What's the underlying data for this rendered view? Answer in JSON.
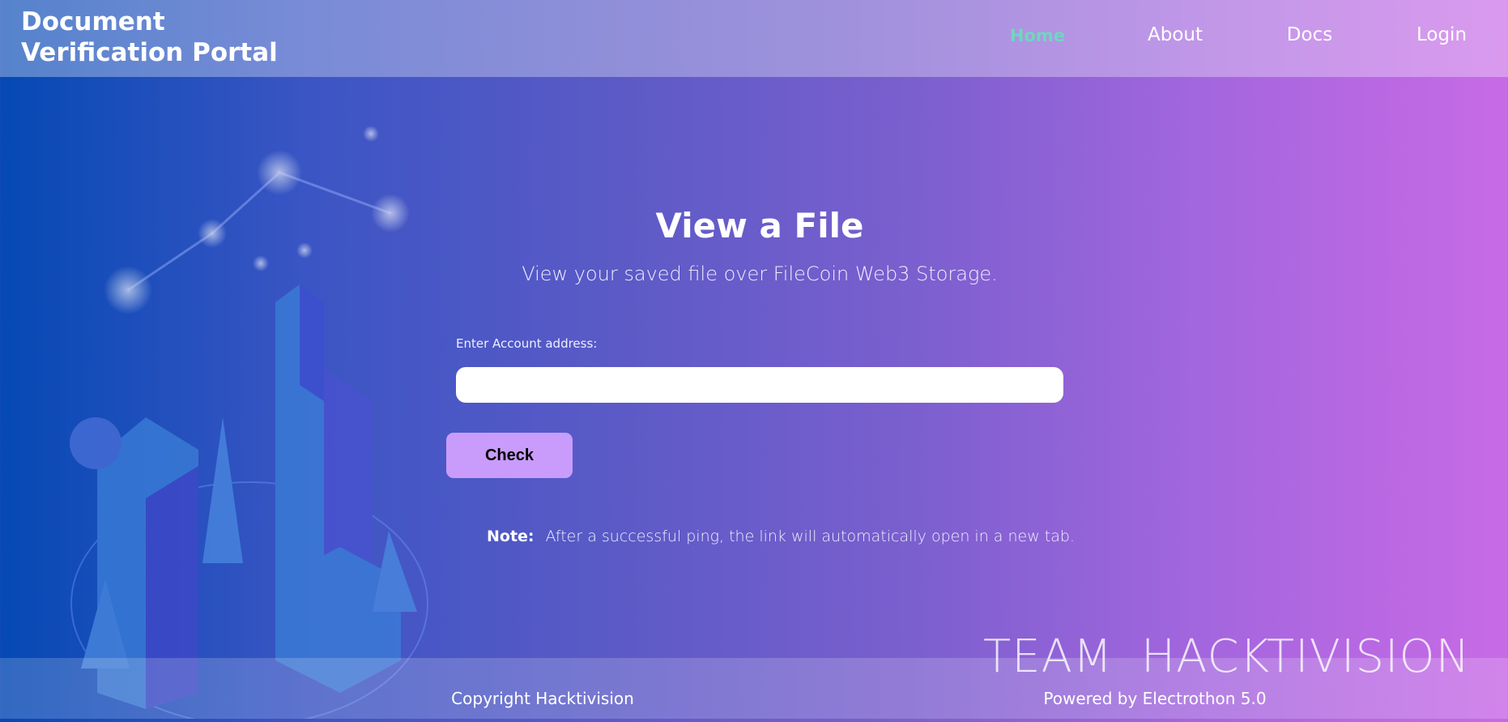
{
  "header": {
    "brand_line1": "Document",
    "brand_line2": "Verification Portal",
    "nav": [
      {
        "label": "Home",
        "active": true
      },
      {
        "label": "About"
      },
      {
        "label": "Docs"
      },
      {
        "label": "Login"
      }
    ],
    "active_color": "#6fd6c0"
  },
  "main": {
    "title": "View a File",
    "subtitle": "View your saved file over FileCoin Web3 Storage.",
    "field_label": "Enter Account address:",
    "field_value": "",
    "check_label": "Check",
    "button_color": "#c99cfc",
    "note_label": "Note:",
    "note_text": "After a successful ping, the link will automatically open in a new tab."
  },
  "watermark": "TEAM HACKTIVISION",
  "footer": {
    "copyright": "Copyright Hacktivision",
    "powered": "Powered by Electrothon 5.0"
  }
}
